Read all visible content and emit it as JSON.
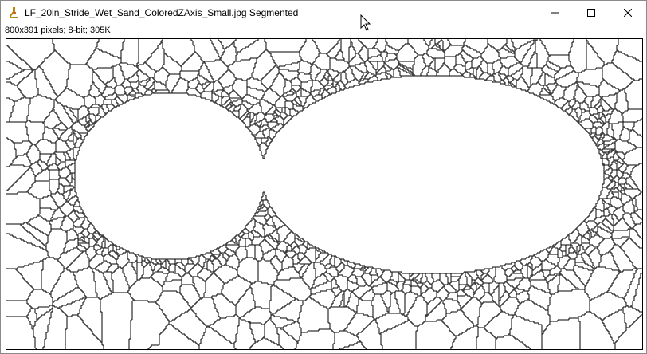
{
  "window": {
    "title": "LF_20in_Stride_Wet_Sand_ColoredZAxis_Small.jpg Segmented",
    "app_icon": "imagej-microscope-icon",
    "controls": [
      "minimize-icon",
      "maximize-icon",
      "close-icon"
    ]
  },
  "info_line": "800x391 pixels; 8-bit; 305K",
  "image": {
    "description_kind": "segmented-cell-boundaries",
    "stroke_color": "#000000",
    "background_color": "#ffffff"
  }
}
